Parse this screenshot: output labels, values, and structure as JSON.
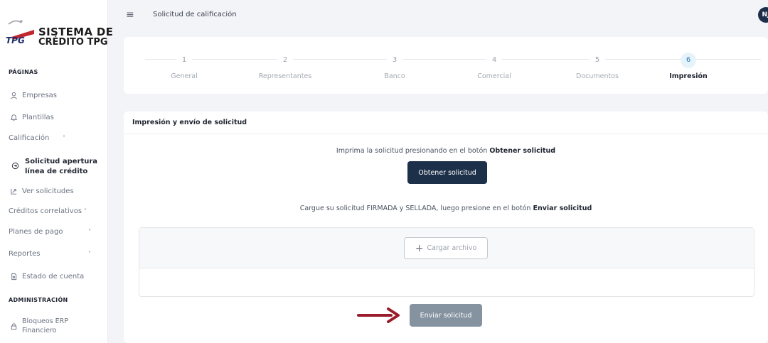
{
  "app": {
    "logo_line1": "SISTEMA DE",
    "logo_line2": "CRÉDITO TPG",
    "logo_mark": "TPG"
  },
  "sidebar": {
    "section_pages": "PÁGINAS",
    "items": [
      {
        "label": "Empresas",
        "icon": "user-icon"
      },
      {
        "label": "Plantillas",
        "icon": "bell-icon"
      },
      {
        "label": "Calificación",
        "chevron": "^"
      },
      {
        "label": "Solicitud apertura línea de crédito",
        "line1": "Solicitud apertura",
        "line2": "línea de crédito",
        "icon": "document-arrow-icon"
      },
      {
        "label": "Ver solicitudes",
        "icon": "share-icon"
      },
      {
        "label": "Créditos correlativos",
        "chevron": "v"
      },
      {
        "label": "Planes de pago",
        "chevron": "v"
      },
      {
        "label": "Reportes",
        "chevron": "v"
      },
      {
        "label": "Estado de cuenta",
        "icon": "file-icon"
      }
    ],
    "section_admin": "ADMINISTRACIÓN",
    "admin_items": [
      {
        "label": "Bloqueos ERP Financiero",
        "line1": "Bloqueos ERP",
        "line2": "Financiero",
        "icon": "lock-icon"
      }
    ]
  },
  "header": {
    "title": "Solicitud de calificación",
    "avatar_initials": "NJ"
  },
  "stepper": {
    "steps": [
      {
        "num": "1",
        "label": "General"
      },
      {
        "num": "2",
        "label": "Representantes"
      },
      {
        "num": "3",
        "label": "Banco"
      },
      {
        "num": "4",
        "label": "Comercial"
      },
      {
        "num": "5",
        "label": "Documentos"
      },
      {
        "num": "6",
        "label": "Impresión",
        "active": true
      }
    ]
  },
  "card": {
    "title": "Impresión y envío de solicitud",
    "instruction1_pre": "Imprima la solicitud presionando en el botón ",
    "instruction1_bold": "Obtener solicitud",
    "get_button": "Obtener solicitud",
    "instruction2_pre": "Cargue su solicitud FIRMADA y SELLADA, luego presione en el botón ",
    "instruction2_bold": "Enviar solicitud",
    "upload_button": "Cargar archivo",
    "send_button": "Enviar solicitud"
  },
  "colors": {
    "primary_dark": "#1d3049",
    "send_gray": "#8592a0",
    "arrow_red": "#9b1c2c",
    "active_step": "#2b7bbf"
  }
}
